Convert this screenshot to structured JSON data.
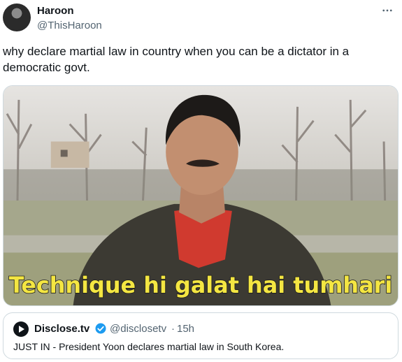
{
  "author": {
    "name": "Haroon",
    "handle": "@ThisHaroon"
  },
  "tweet": {
    "text": "why declare martial law in country when you can be a dictator in a democratic govt.",
    "meme_caption": "Technique hi galat hai tumhari"
  },
  "quoted": {
    "name": "Disclose.tv",
    "handle": "@disclosetv",
    "separator": "·",
    "time": "15h",
    "text": "JUST IN - President Yoon declares martial law in South Korea."
  },
  "icons": {
    "more": "more-dots-icon",
    "verified": "verified-badge-icon",
    "quoted_logo": "play-logo-icon"
  },
  "colors": {
    "text": "#0f1419",
    "secondary": "#536471",
    "verified": "#1d9bf0",
    "border": "#cfd9de"
  }
}
